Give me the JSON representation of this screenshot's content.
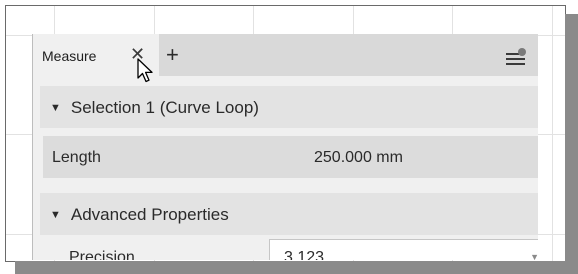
{
  "tab": {
    "label": "Measure",
    "close_glyph": "✕",
    "add_glyph": "+"
  },
  "icons": {
    "menu": "menu-lines-icon",
    "cursor": "mouse-pointer-icon"
  },
  "sections": [
    {
      "caret": "▼",
      "title": "Selection 1 (Curve Loop)"
    },
    {
      "caret": "▼",
      "title": "Advanced Properties"
    }
  ],
  "length_row": {
    "label": "Length",
    "value": "250.000 mm"
  },
  "precision_row": {
    "label": "Precision",
    "value": "3.123",
    "arrow": "▼"
  }
}
